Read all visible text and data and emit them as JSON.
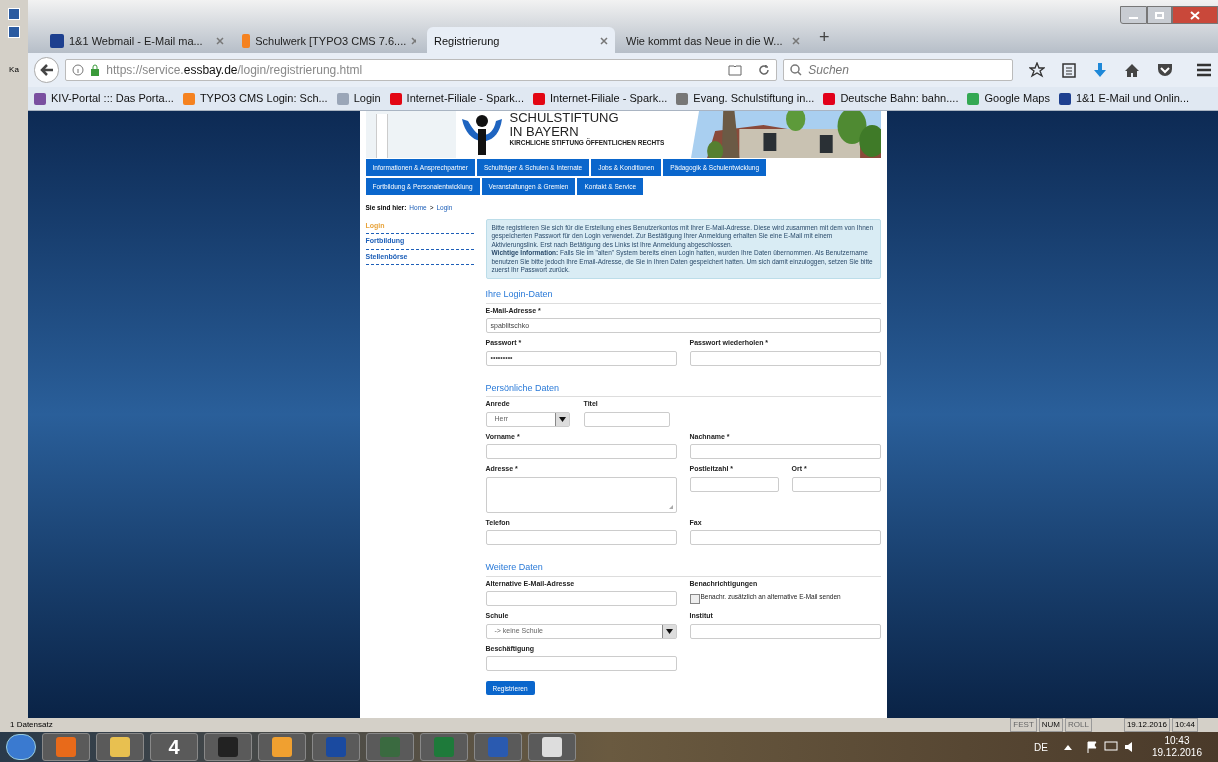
{
  "left_strip": {
    "label": "Ka"
  },
  "tabs": [
    {
      "title": "1&1 Webmail - E-Mail ma...",
      "selected": false
    },
    {
      "title": "Schulwerk [TYPO3 CMS 7.6....",
      "selected": false
    },
    {
      "title": "Registrierung",
      "selected": true
    },
    {
      "title": "Wie kommt das Neue in die W...",
      "selected": false
    }
  ],
  "new_tab": "+",
  "url": {
    "prefix": "https://service.",
    "domain": "essbay.de",
    "path": "/login/registrierung.html"
  },
  "search": {
    "placeholder": "Suchen"
  },
  "bookmarks": [
    "KIV-Portal ::: Das Porta...",
    "TYPO3 CMS Login: Sch...",
    "Login",
    "Internet-Filiale - Spark...",
    "Internet-Filiale - Spark...",
    "Evang. Schulstiftung in...",
    "Deutsche Bahn: bahn....",
    "Google Maps",
    "1&1 E-Mail und Onlin..."
  ],
  "header": {
    "title_1": "SCHULSTIFTUNG",
    "title_2": "IN BAYERN",
    "subtitle": "KIRCHLICHE STIFTUNG ÖFFENTLICHEN RECHTS"
  },
  "nav_rows": [
    [
      "Informationen & Ansprechpartner",
      "Schulträger & Schulen & Internate",
      "Jobs & Konditionen",
      "Pädagogik & Schulentwicklung"
    ],
    [
      "Fortbildung & Personalentwicklung",
      "Veranstaltungen & Gremien",
      "Kontakt & Service"
    ]
  ],
  "breadcrumb": {
    "label": "Sie sind hier:",
    "items": [
      "Home",
      "Login"
    ],
    "separator": ">"
  },
  "sidebar": [
    {
      "label": "Login",
      "selected": true
    },
    {
      "label": "Fortbildung",
      "selected": false
    },
    {
      "label": "Stellenbörse",
      "selected": false
    }
  ],
  "info": "Bitte registrieren Sie sich für die Erstellung eines Benutzerkontos mit Ihrer E-Mail-Adresse. Diese wird zusammen mit dem von Ihnen gespeicherten Passwort für den Login verwendet. Zur Bestätigung Ihrer Anmeldung erhalten Sie eine E-Mail mit einem Aktivierungslink. Erst nach Betätigung des Links ist Ihre Anmeldung abgeschlossen.",
  "info_2": "**Wichtige Information:** Falls Sie im \"alten\" System bereits einen Login hatten, wurden Ihre Daten übernommen. Als Benutzername benutzen Sie bitte jedoch Ihre Email-Adresse, die Sie in Ihren Daten gespeichert hatten. Um sich damit einzuloggen, setzen Sie bitte zuerst Ihr Passwort zurück.",
  "sections": [
    {
      "title": "Ihre Login-Daten",
      "rows": [
        [
          {
            "kind": "wide-text",
            "label": "E-Mail-Adresse *",
            "value": "spablitschko"
          }
        ],
        [
          {
            "kind": "text",
            "label": "Passwort *",
            "value": "•••••••••"
          },
          {
            "kind": "text",
            "label": "Passwort wiederholen *"
          }
        ]
      ]
    },
    {
      "title": "Persönliche Daten",
      "rows": [
        [
          {
            "kind": "short-select",
            "label": "Anrede",
            "value": "Herr"
          },
          {
            "kind": "short-text",
            "label": "Titel"
          }
        ],
        [
          {
            "kind": "text",
            "label": "Vorname *"
          },
          {
            "kind": "text",
            "label": "Nachname *"
          }
        ],
        [
          {
            "kind": "textarea",
            "label": "Adresse *"
          },
          {
            "kind": "text",
            "label": "Postleitzahl *"
          },
          {
            "kind": "text",
            "label": "Ort *"
          }
        ],
        [
          {
            "kind": "text",
            "label": "Telefon"
          },
          {
            "kind": "text",
            "label": "Fax"
          }
        ]
      ]
    },
    {
      "title": "Weitere Daten",
      "rows": [
        [
          {
            "kind": "text",
            "label": "Alternative E-Mail-Adresse"
          },
          {
            "kind": "checkbox",
            "label": "Benachrichtigungen",
            "option": "Benachr. zusätzlich an alternative E-Mail senden",
            "checked": false
          }
        ],
        [
          {
            "kind": "select",
            "label": "Schule",
            "value": "-> keine Schule"
          },
          {
            "kind": "text",
            "label": "Institut"
          }
        ],
        [
          {
            "kind": "text",
            "label": "Beschäftigung"
          }
        ]
      ]
    }
  ],
  "submit": "Registrieren",
  "status_bar": {
    "text": "1 Datensatz",
    "indicators": [
      {
        "label": "FEST",
        "on": false
      },
      {
        "label": "NUM",
        "on": true
      },
      {
        "label": "ROLL",
        "on": false
      }
    ],
    "date": "19.12.2016",
    "time": "10:44"
  },
  "taskbar": {
    "icon_4": "4",
    "language": "DE",
    "time": "10:43",
    "date": "19.12.2016"
  }
}
